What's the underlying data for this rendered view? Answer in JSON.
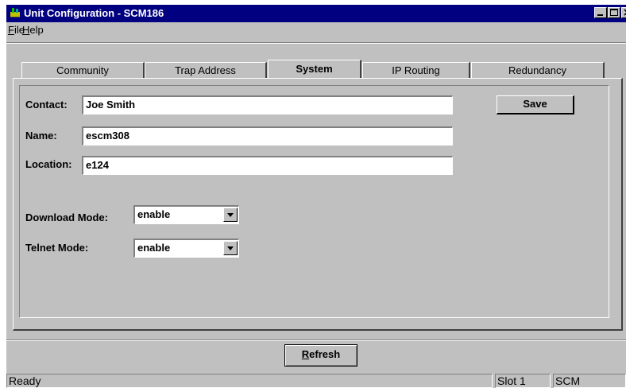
{
  "window": {
    "title": "Unit Configuration - SCM186",
    "accent": "#000080"
  },
  "menu": {
    "file": {
      "mnemonic": "F",
      "rest": "ile"
    },
    "help": {
      "mnemonic": "H",
      "rest": "elp"
    }
  },
  "tabs": [
    {
      "label": "Community",
      "active": false
    },
    {
      "label": "Trap Address",
      "active": false
    },
    {
      "label": "System",
      "active": true
    },
    {
      "label": "IP Routing",
      "active": false
    },
    {
      "label": "Redundancy",
      "active": false
    }
  ],
  "form": {
    "contact_label": "Contact:",
    "contact_value": "Joe Smith",
    "name_label": "Name:",
    "name_value": "escm308",
    "location_label": "Location:",
    "location_value": "e124",
    "download_label": "Download Mode:",
    "download_value": "enable",
    "telnet_label": "Telnet Mode:",
    "telnet_value": "enable",
    "save_label": "Save"
  },
  "footer": {
    "refresh_mnemonic": "R",
    "refresh_rest": "efresh"
  },
  "status": {
    "ready": "Ready",
    "slot": "Slot 1",
    "module": "SCM"
  }
}
